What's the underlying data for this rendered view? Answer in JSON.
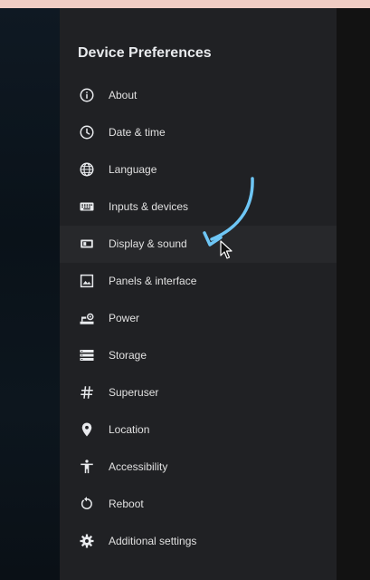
{
  "panel": {
    "title": "Device Preferences",
    "items": [
      {
        "label": "About",
        "icon": "info-icon"
      },
      {
        "label": "Date & time",
        "icon": "clock-icon"
      },
      {
        "label": "Language",
        "icon": "globe-icon"
      },
      {
        "label": "Inputs & devices",
        "icon": "keyboard-icon"
      },
      {
        "label": "Display & sound",
        "icon": "display-icon",
        "selected": true
      },
      {
        "label": "Panels & interface",
        "icon": "image-icon"
      },
      {
        "label": "Power",
        "icon": "power-icon"
      },
      {
        "label": "Storage",
        "icon": "storage-icon"
      },
      {
        "label": "Superuser",
        "icon": "hash-icon"
      },
      {
        "label": "Location",
        "icon": "location-pin-icon"
      },
      {
        "label": "Accessibility",
        "icon": "accessibility-icon"
      },
      {
        "label": "Reboot",
        "icon": "reboot-icon"
      },
      {
        "label": "Additional settings",
        "icon": "gear-icon"
      }
    ]
  },
  "colors": {
    "panel_background": "#202124",
    "selected_row": "#27282b",
    "annotation_arrow": "#6ec6f5",
    "top_bar": "#f0cdc4"
  }
}
